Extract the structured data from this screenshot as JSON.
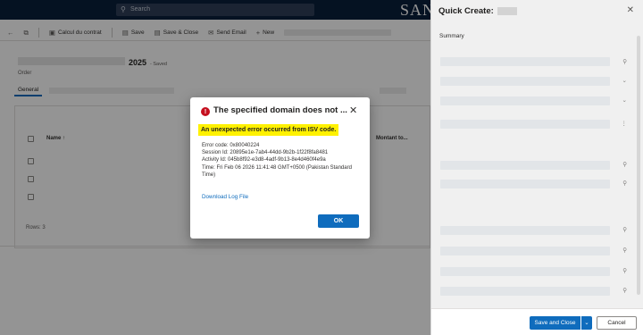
{
  "topbar": {
    "search_placeholder": "Search",
    "brand": "SAN"
  },
  "cmdbar": {
    "items": [
      {
        "icon": "back-arrow-icon",
        "glyph": "←",
        "label": ""
      },
      {
        "icon": "popout-icon",
        "glyph": "⧉",
        "label": ""
      },
      {
        "icon": "calculator-icon",
        "glyph": "▣",
        "label": "Calcul du contrat"
      },
      {
        "icon": "save-icon",
        "glyph": "▤",
        "label": "Save"
      },
      {
        "icon": "save-close-icon",
        "glyph": "▤",
        "label": "Save & Close"
      },
      {
        "icon": "email-icon",
        "glyph": "✉",
        "label": "Send Email"
      },
      {
        "icon": "plus-icon",
        "glyph": "+",
        "label": "New"
      }
    ]
  },
  "record": {
    "year": "2025",
    "status": "- Saved",
    "entity": "Order"
  },
  "tabs": {
    "general": "General"
  },
  "grid": {
    "col_name": "Name ↑",
    "col_amount": "Montant to...",
    "rows_label": "Rows: 3"
  },
  "quick_create": {
    "title": "Quick Create:",
    "summary": "Summary",
    "save_close": "Save and Close",
    "cancel": "Cancel"
  },
  "dialog": {
    "title": "The specified domain does not ...",
    "highlight": "An unexpected error occurred from ISV code.",
    "error_code": "Error code: 0x80040224",
    "session_id": "Session Id: 20895e1e-7ab4-44dd-9b2b-1f22f8fa8481",
    "activity_id": "Activity Id: 045b8f92-e3d8-4adf-9b13-8e4d460f4e9a",
    "time": "Time: Fri Feb 06 2026 11:41:48 GMT+0500 (Pakistan Standard Time)",
    "download_link": "Download Log File",
    "ok": "OK"
  },
  "colors": {
    "accent": "#0f6cbd",
    "error": "#c50f1f",
    "highlight": "#fff100",
    "topbar": "#0a1f3c"
  }
}
